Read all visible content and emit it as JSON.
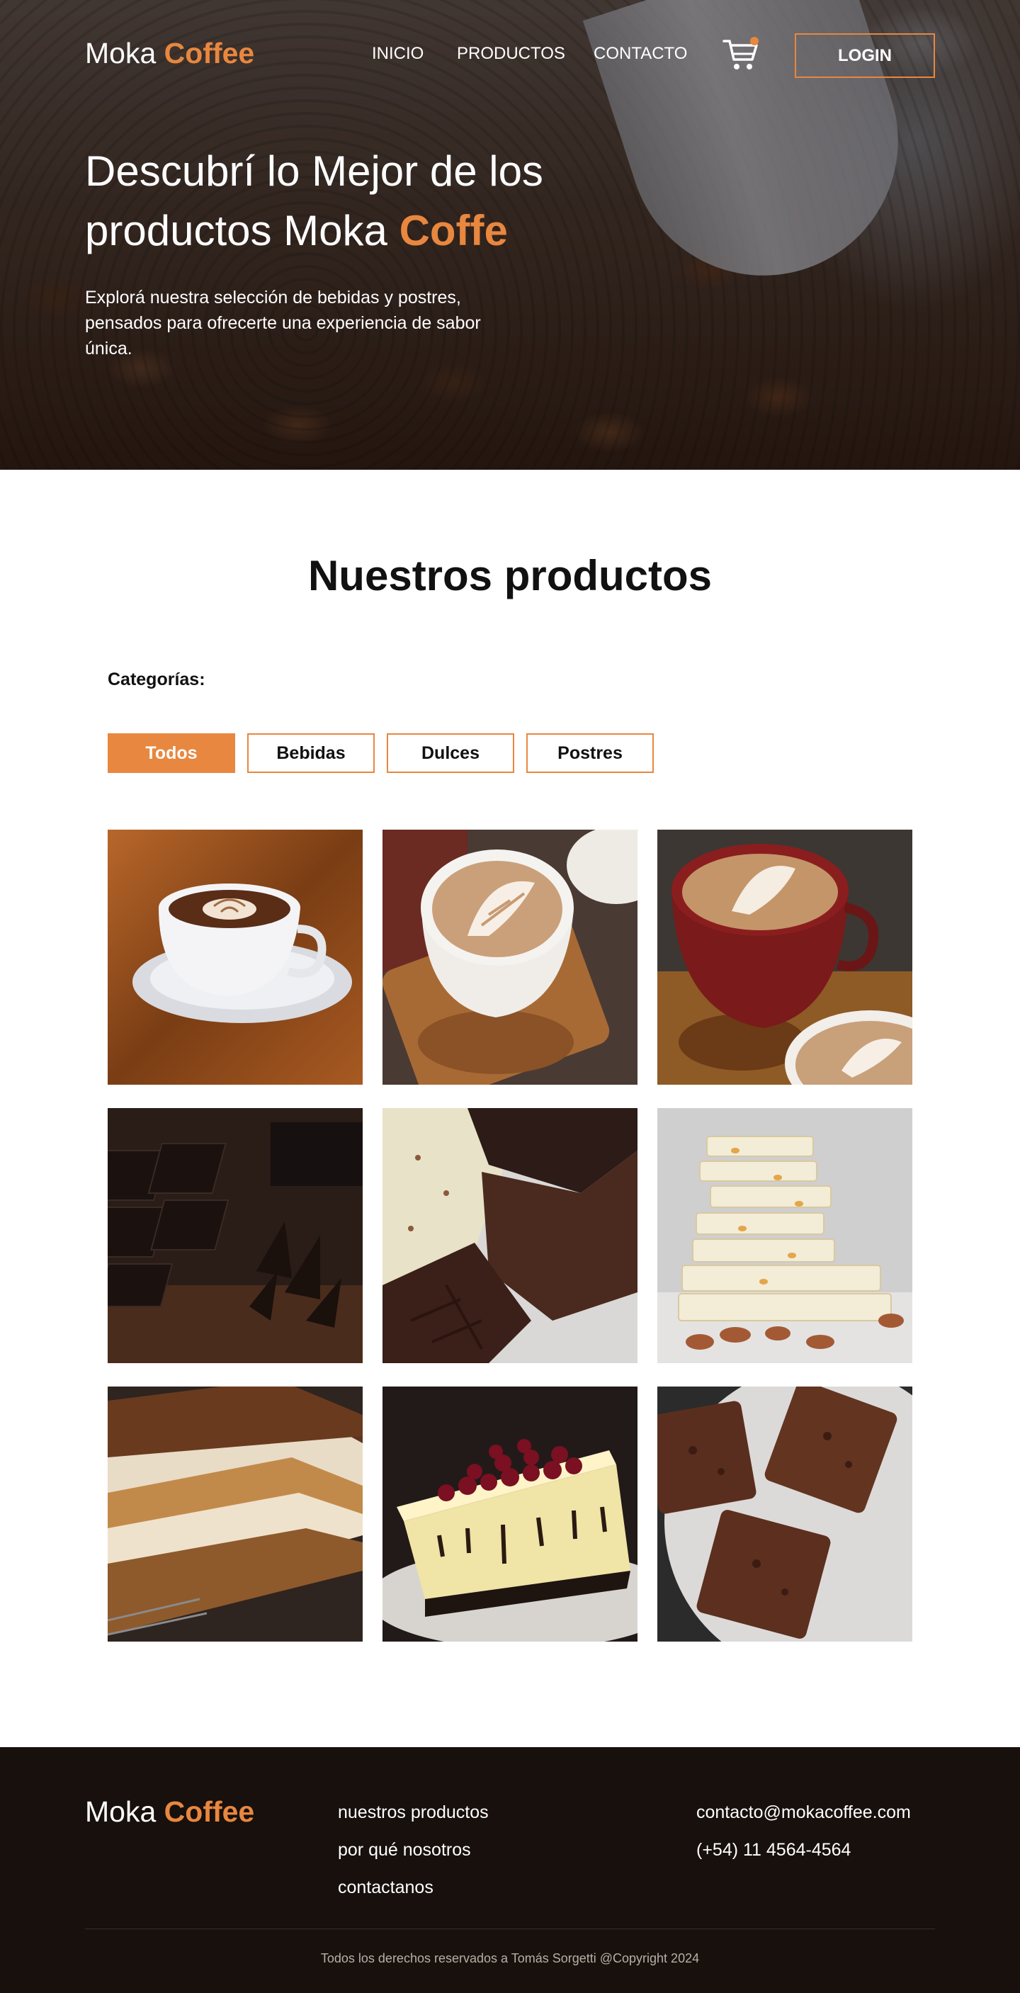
{
  "brand": {
    "name": "Moka",
    "accent": "Coffee"
  },
  "nav": {
    "items": [
      {
        "label": "INICIO"
      },
      {
        "label": "PRODUCTOS"
      },
      {
        "label": "CONTACTO"
      }
    ],
    "cart_icon": "shopping-cart-icon",
    "login_label": "LOGIN"
  },
  "hero": {
    "title_plain": "Descubrí lo Mejor de los productos Moka ",
    "title_accent": "Coffe",
    "description": "Explorá nuestra selección de bebidas y postres, pensados para ofrecerte una experiencia de sabor única."
  },
  "products": {
    "title": "Nuestros productos",
    "categories_label": "Categorías:",
    "filters": [
      {
        "label": "Todos",
        "active": true
      },
      {
        "label": "Bebidas",
        "active": false
      },
      {
        "label": "Dulces",
        "active": false
      },
      {
        "label": "Postres",
        "active": false
      }
    ],
    "items": [
      {
        "image": "latte-art-cup-on-wooden-table"
      },
      {
        "image": "latte-art-cup-on-wooden-coaster"
      },
      {
        "image": "latte-in-red-cup"
      },
      {
        "image": "dark-chocolate-bars-with-shavings"
      },
      {
        "image": "broken-chocolate-pieces"
      },
      {
        "image": "stacked-white-chocolate-with-almonds"
      },
      {
        "image": "tiramisu-slice"
      },
      {
        "image": "cheesecake-with-berries"
      },
      {
        "image": "brownies-on-plate"
      }
    ]
  },
  "footer": {
    "links": [
      {
        "label": "nuestros productos"
      },
      {
        "label": "por qué nosotros"
      },
      {
        "label": "contactanos"
      }
    ],
    "email": "contacto@mokacoffee.com",
    "phone": "(+54) 11 4564-4564",
    "copyright": "Todos los derechos reservados a Tomás Sorgetti @Copyright 2024"
  },
  "colors": {
    "accent": "#e8873f",
    "footer_bg": "#17100c",
    "text_dark": "#111111"
  }
}
